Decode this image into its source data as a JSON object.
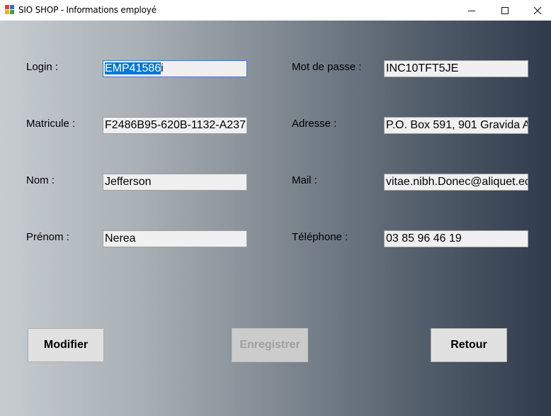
{
  "window": {
    "title": "SIO SHOP - Informations employé",
    "controls": {
      "minimize": "—",
      "maximize": "☐",
      "close": "✕"
    }
  },
  "form": {
    "login": {
      "label": "Login :",
      "value_selected": "EMP41586",
      "value_rest": "i"
    },
    "password": {
      "label": "Mot de passe :",
      "value": "INC10TFT5JE"
    },
    "matricule": {
      "label": "Matricule :",
      "value": "F2486B95-620B-1132-A237"
    },
    "adresse": {
      "label": "Adresse :",
      "value": "P.O. Box 591, 901 Gravida A"
    },
    "nom": {
      "label": "Nom :",
      "value": "Jefferson"
    },
    "mail": {
      "label": "Mail :",
      "value": "vitae.nibh.Donec@aliquet.ec"
    },
    "prenom": {
      "label": "Prénom :",
      "value": "Nerea"
    },
    "telephone": {
      "label": "Téléphone :",
      "value": "03 85 96 46 19"
    }
  },
  "buttons": {
    "modifier": "Modifier",
    "enregistrer": "Enregistrer",
    "retour": "Retour"
  },
  "colors": {
    "gradient_start": "#c6ccd0",
    "gradient_end": "#2f3b4b",
    "selection": "#0078d7"
  }
}
